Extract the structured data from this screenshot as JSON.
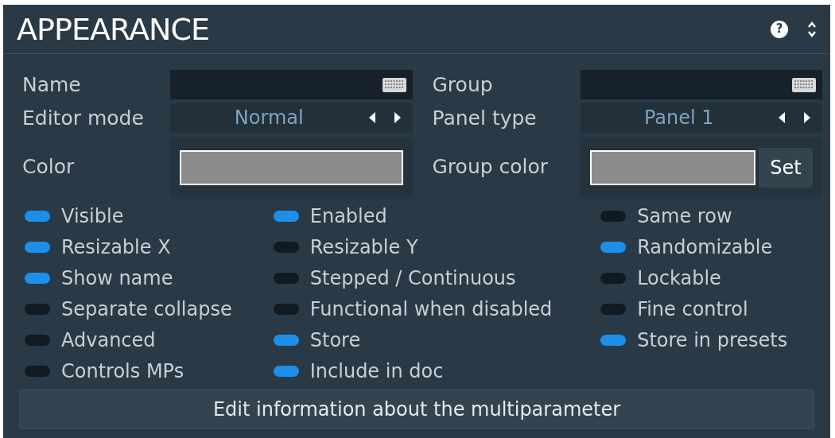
{
  "title": "APPEARANCE",
  "help": "?",
  "fields": [
    {
      "kind": "text",
      "label": "Name"
    },
    {
      "kind": "text",
      "label": "Group"
    },
    {
      "kind": "choice",
      "label": "Editor mode",
      "value": "Normal"
    },
    {
      "kind": "choice",
      "label": "Panel type",
      "value": "Panel 1"
    },
    {
      "kind": "color",
      "label": "Color",
      "color": "#8c8c8c"
    },
    {
      "kind": "color",
      "label": "Group color",
      "color": "#8c8c8c",
      "button": "Set"
    }
  ],
  "toggle_columns": [
    [
      {
        "label": "Visible",
        "on": true
      },
      {
        "label": "Resizable X",
        "on": true
      },
      {
        "label": "Show name",
        "on": true
      },
      {
        "label": "Separate collapse",
        "on": false
      },
      {
        "label": "Advanced",
        "on": false
      },
      {
        "label": "Controls MPs",
        "on": false
      }
    ],
    [
      {
        "label": "Enabled",
        "on": true
      },
      {
        "label": "Resizable Y",
        "on": false
      },
      {
        "label": "Stepped / Continuous",
        "on": false
      },
      {
        "label": "Functional when disabled",
        "on": false
      },
      {
        "label": "Store",
        "on": true
      },
      {
        "label": "Include in doc",
        "on": true
      }
    ],
    [
      {
        "label": "Same row",
        "on": false
      },
      {
        "label": "Randomizable",
        "on": true
      },
      {
        "label": "Lockable",
        "on": false
      },
      {
        "label": "Fine control",
        "on": false
      },
      {
        "label": "Store in presets",
        "on": true
      }
    ]
  ],
  "edit_button": "Edit information about the multiparameter"
}
